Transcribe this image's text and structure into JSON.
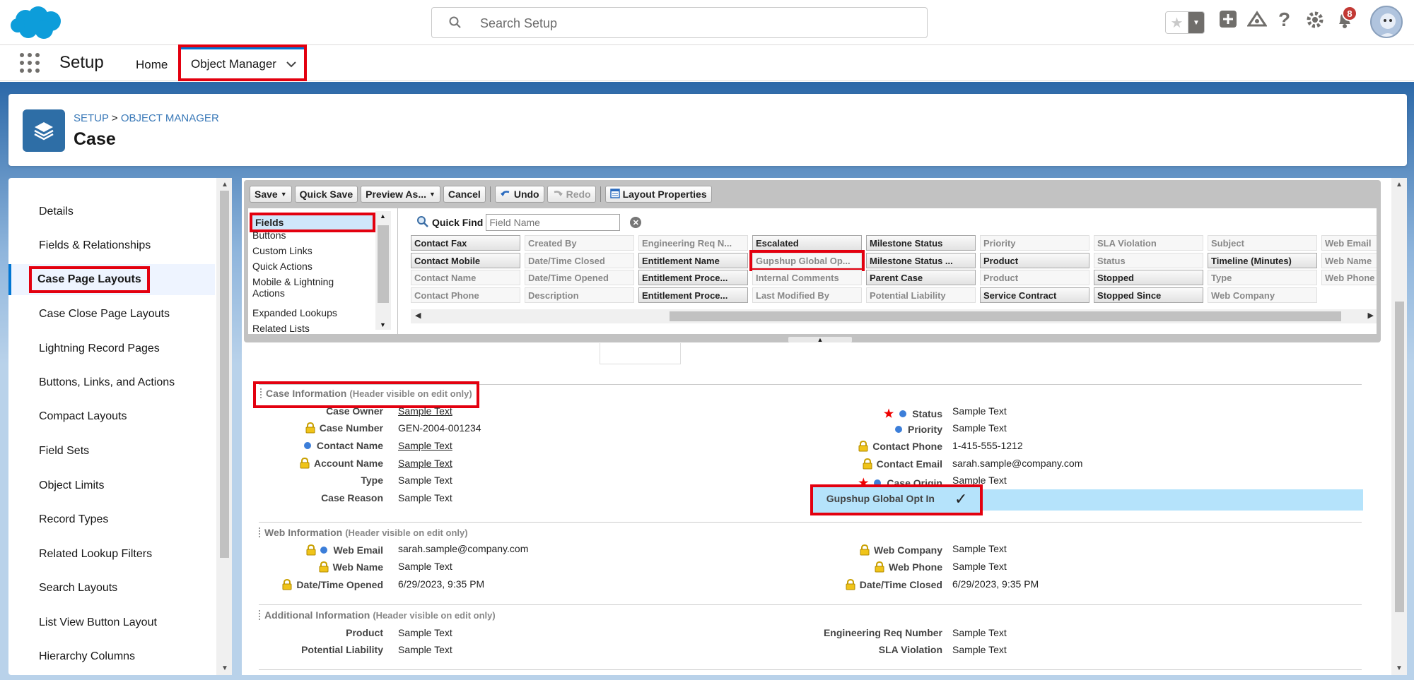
{
  "header": {
    "search_placeholder": "Search Setup",
    "notifications_count": "8"
  },
  "nav": {
    "app_title": "Setup",
    "tab_home": "Home",
    "tab_object_manager": "Object Manager"
  },
  "object_header": {
    "breadcrumb_setup": "SETUP",
    "breadcrumb_sep": ">",
    "breadcrumb_object_manager": "OBJECT MANAGER",
    "title": "Case"
  },
  "sidebar": {
    "items": [
      {
        "label": "Details"
      },
      {
        "label": "Fields & Relationships"
      },
      {
        "label": "Case Page Layouts"
      },
      {
        "label": "Case Close Page Layouts"
      },
      {
        "label": "Lightning Record Pages"
      },
      {
        "label": "Buttons, Links, and Actions"
      },
      {
        "label": "Compact Layouts"
      },
      {
        "label": "Field Sets"
      },
      {
        "label": "Object Limits"
      },
      {
        "label": "Record Types"
      },
      {
        "label": "Related Lookup Filters"
      },
      {
        "label": "Search Layouts"
      },
      {
        "label": "List View Button Layout"
      },
      {
        "label": "Hierarchy Columns"
      }
    ]
  },
  "toolbar": {
    "save": "Save",
    "quick_save": "Quick Save",
    "preview_as": "Preview As...",
    "cancel": "Cancel",
    "undo": "Undo",
    "redo": "Redo",
    "layout_properties": "Layout Properties"
  },
  "palette": {
    "categories": [
      "Fields",
      "Buttons",
      "Custom Links",
      "Quick Actions",
      "Mobile & Lightning Actions",
      "Expanded Lookups",
      "Related Lists"
    ],
    "quick_find_label": "Quick Find",
    "quick_find_placeholder": "Field Name",
    "fields": [
      [
        "Contact Fax",
        "Created By",
        "Engineering Req N...",
        "Escalated",
        "Milestone Status",
        "Priority",
        "SLA Violation",
        "Subject",
        "Web Email"
      ],
      [
        "Contact Mobile",
        "Date/Time Closed",
        "Entitlement Name",
        "Gupshup Global Op...",
        "Milestone Status ...",
        "Product",
        "Status",
        "Timeline (Minutes)",
        "Web Name"
      ],
      [
        "Contact Name",
        "Date/Time Opened",
        "Entitlement Proce...",
        "Internal Comments",
        "Parent Case",
        "Product",
        "Stopped",
        "Type",
        "Web Phone"
      ],
      [
        "Contact Phone",
        "Description",
        "Entitlement Proce...",
        "Last Modified By",
        "Potential Liability",
        "Service Contract",
        "Stopped Since",
        "Web Company",
        ""
      ]
    ],
    "available": [
      [
        true,
        false,
        false,
        true,
        true,
        false,
        false,
        false,
        false
      ],
      [
        true,
        false,
        true,
        false,
        true,
        true,
        false,
        true,
        false
      ],
      [
        false,
        false,
        true,
        false,
        true,
        false,
        true,
        false,
        false
      ],
      [
        false,
        false,
        true,
        false,
        false,
        true,
        true,
        false,
        false
      ]
    ]
  },
  "layout": {
    "case_info": {
      "title": "Case Information",
      "subtitle": "(Header visible on edit only)",
      "left": [
        {
          "label": "Case Owner",
          "value": "Sample Text"
        },
        {
          "label": "Case Number",
          "value": "GEN-2004-001234"
        },
        {
          "label": "Contact Name",
          "value": "Sample Text"
        },
        {
          "label": "Account Name",
          "value": "Sample Text"
        },
        {
          "label": "Type",
          "value": "Sample Text"
        },
        {
          "label": "Case Reason",
          "value": "Sample Text"
        }
      ],
      "right": [
        {
          "label": "Status",
          "value": "Sample Text"
        },
        {
          "label": "Priority",
          "value": "Sample Text"
        },
        {
          "label": "Contact Phone",
          "value": "1-415-555-1212"
        },
        {
          "label": "Contact Email",
          "value": "sarah.sample@company.com"
        },
        {
          "label": "Case Origin",
          "value": "Sample Text"
        },
        {
          "label": "Gupshup Global Opt In",
          "value": "✓"
        }
      ]
    },
    "web_info": {
      "title": "Web Information",
      "subtitle": "(Header visible on edit only)",
      "left": [
        {
          "label": "Web Email",
          "value": "sarah.sample@company.com"
        },
        {
          "label": "Web Name",
          "value": "Sample Text"
        },
        {
          "label": "Date/Time Opened",
          "value": "6/29/2023, 9:35 PM"
        }
      ],
      "right": [
        {
          "label": "Web Company",
          "value": "Sample Text"
        },
        {
          "label": "Web Phone",
          "value": "Sample Text"
        },
        {
          "label": "Date/Time Closed",
          "value": "6/29/2023, 9:35 PM"
        }
      ]
    },
    "additional_info": {
      "title": "Additional Information",
      "subtitle": "(Header visible on edit only)",
      "left": [
        {
          "label": "Product",
          "value": "Sample Text"
        },
        {
          "label": "Potential Liability",
          "value": "Sample Text"
        }
      ],
      "right": [
        {
          "label": "Engineering Req Number",
          "value": "Sample Text"
        },
        {
          "label": "SLA Violation",
          "value": "Sample Text"
        }
      ]
    }
  },
  "colors": {
    "highlight": "#e3000f",
    "brand_blue": "#0176d3",
    "field_highlight": "#b5e3fb"
  }
}
